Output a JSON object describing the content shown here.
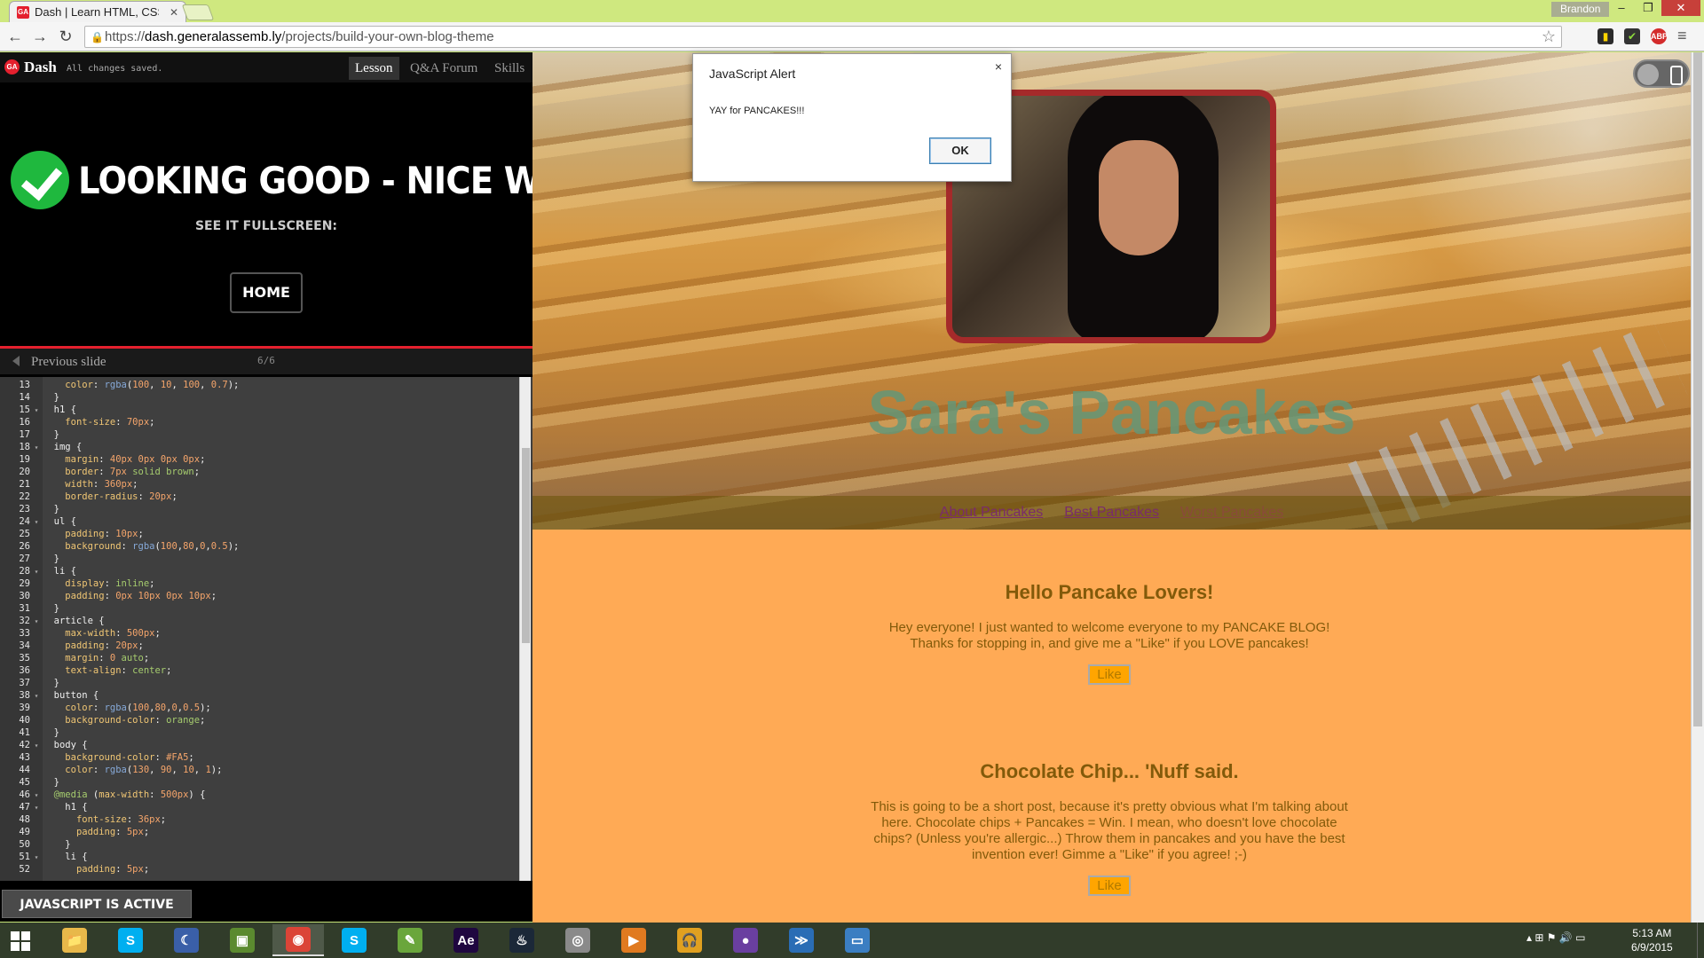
{
  "browser": {
    "tab_title": "Dash | Learn HTML, CSS, J",
    "tab_favicon_text": "GA",
    "user_name": "Brandon",
    "url": {
      "prefix": "https://",
      "host": "dash.generalassemb.ly",
      "path": "/projects/build-your-own-blog-theme"
    },
    "window_controls": {
      "minimize": "–",
      "maximize": "❐",
      "close": "✕"
    }
  },
  "dash": {
    "logo_text": "GA",
    "brand": "Dash",
    "save_status": "All changes saved.",
    "tabs": [
      {
        "label": "Lesson",
        "active": true
      },
      {
        "label": "Q&A Forum",
        "active": false
      },
      {
        "label": "Skills",
        "active": false
      }
    ],
    "success_title": "LOOKING GOOD - NICE WORK!",
    "fullscreen_label": "SEE IT FULLSCREEN:",
    "home_button": "HOME",
    "previous_slide": "Previous slide",
    "slide_count": "6/6",
    "js_status": "JAVASCRIPT IS ACTIVE"
  },
  "editor": {
    "lines": [
      {
        "n": "13",
        "fold": "",
        "indent": "    ",
        "html": "<span class=\"prop\">color</span>: <span class=\"fn\">rgba</span>(<span class=\"num\">100</span>, <span class=\"num\">10</span>, <span class=\"num\">100</span>, <span class=\"num\">0.7</span>);"
      },
      {
        "n": "14",
        "fold": "",
        "indent": "  ",
        "html": "}"
      },
      {
        "n": "15",
        "fold": "▾",
        "indent": "  ",
        "html": "h1 {"
      },
      {
        "n": "16",
        "fold": "",
        "indent": "    ",
        "html": "<span class=\"prop\">font-size</span>: <span class=\"num\">70px</span>;"
      },
      {
        "n": "17",
        "fold": "",
        "indent": "  ",
        "html": "}"
      },
      {
        "n": "18",
        "fold": "▾",
        "indent": "  ",
        "html": "img {"
      },
      {
        "n": "19",
        "fold": "",
        "indent": "    ",
        "html": "<span class=\"prop\">margin</span>: <span class=\"num\">40px</span> <span class=\"num\">0px</span> <span class=\"num\">0px</span> <span class=\"num\">0px</span>;"
      },
      {
        "n": "20",
        "fold": "",
        "indent": "    ",
        "html": "<span class=\"prop\">border</span>: <span class=\"num\">7px</span> <span class=\"kw\">solid</span> <span class=\"kw\">brown</span>;"
      },
      {
        "n": "21",
        "fold": "",
        "indent": "    ",
        "html": "<span class=\"prop\">width</span>: <span class=\"num\">360px</span>;"
      },
      {
        "n": "22",
        "fold": "",
        "indent": "    ",
        "html": "<span class=\"prop\">border-radius</span>: <span class=\"num\">20px</span>;"
      },
      {
        "n": "23",
        "fold": "",
        "indent": "  ",
        "html": "}"
      },
      {
        "n": "24",
        "fold": "▾",
        "indent": "  ",
        "html": "ul {"
      },
      {
        "n": "25",
        "fold": "",
        "indent": "    ",
        "html": "<span class=\"prop\">padding</span>: <span class=\"num\">10px</span>;"
      },
      {
        "n": "26",
        "fold": "",
        "indent": "    ",
        "html": "<span class=\"prop\">background</span>: <span class=\"fn\">rgba</span>(<span class=\"num\">100</span>,<span class=\"num\">80</span>,<span class=\"num\">0</span>,<span class=\"num\">0.5</span>);"
      },
      {
        "n": "27",
        "fold": "",
        "indent": "  ",
        "html": "}"
      },
      {
        "n": "28",
        "fold": "▾",
        "indent": "  ",
        "html": "li {"
      },
      {
        "n": "29",
        "fold": "",
        "indent": "    ",
        "html": "<span class=\"prop\">display</span>: <span class=\"kw\">inline</span>;"
      },
      {
        "n": "30",
        "fold": "",
        "indent": "    ",
        "html": "<span class=\"prop\">padding</span>: <span class=\"num\">0px</span> <span class=\"num\">10px</span> <span class=\"num\">0px</span> <span class=\"num\">10px</span>;"
      },
      {
        "n": "31",
        "fold": "",
        "indent": "  ",
        "html": "}"
      },
      {
        "n": "32",
        "fold": "▾",
        "indent": "  ",
        "html": "article {"
      },
      {
        "n": "33",
        "fold": "",
        "indent": "    ",
        "html": "<span class=\"prop\">max-width</span>: <span class=\"num\">500px</span>;"
      },
      {
        "n": "34",
        "fold": "",
        "indent": "    ",
        "html": "<span class=\"prop\">padding</span>: <span class=\"num\">20px</span>;"
      },
      {
        "n": "35",
        "fold": "",
        "indent": "    ",
        "html": "<span class=\"prop\">margin</span>: <span class=\"num\">0</span> <span class=\"kw\">auto</span>;"
      },
      {
        "n": "36",
        "fold": "",
        "indent": "    ",
        "html": "<span class=\"prop\">text-align</span>: <span class=\"kw\">center</span>;"
      },
      {
        "n": "37",
        "fold": "",
        "indent": "  ",
        "html": "}"
      },
      {
        "n": "38",
        "fold": "▾",
        "indent": "  ",
        "html": "button {"
      },
      {
        "n": "39",
        "fold": "",
        "indent": "    ",
        "html": "<span class=\"prop\">color</span>: <span class=\"fn\">rgba</span>(<span class=\"num\">100</span>,<span class=\"num\">80</span>,<span class=\"num\">0</span>,<span class=\"num\">0.5</span>);"
      },
      {
        "n": "40",
        "fold": "",
        "indent": "    ",
        "html": "<span class=\"prop\">background-color</span>: <span class=\"kw\">orange</span>;"
      },
      {
        "n": "41",
        "fold": "",
        "indent": "  ",
        "html": "}"
      },
      {
        "n": "42",
        "fold": "▾",
        "indent": "  ",
        "html": "body {"
      },
      {
        "n": "43",
        "fold": "",
        "indent": "    ",
        "html": "<span class=\"prop\">background-color</span>: <span class=\"num\">#FA5</span>;"
      },
      {
        "n": "44",
        "fold": "",
        "indent": "    ",
        "html": "<span class=\"prop\">color</span>: <span class=\"fn\">rgba</span>(<span class=\"num\">130</span>, <span class=\"num\">90</span>, <span class=\"num\">10</span>, <span class=\"num\">1</span>);"
      },
      {
        "n": "45",
        "fold": "",
        "indent": "  ",
        "html": "}"
      },
      {
        "n": "46",
        "fold": "▾",
        "indent": "  ",
        "html": "<span class=\"kw\">@media</span> (<span class=\"prop\">max-width</span>: <span class=\"num\">500px</span>) {"
      },
      {
        "n": "47",
        "fold": "▾",
        "indent": "    ",
        "html": "h1 {"
      },
      {
        "n": "48",
        "fold": "",
        "indent": "      ",
        "html": "<span class=\"prop\">font-size</span>: <span class=\"num\">36px</span>;"
      },
      {
        "n": "49",
        "fold": "",
        "indent": "      ",
        "html": "<span class=\"prop\">padding</span>: <span class=\"num\">5px</span>;"
      },
      {
        "n": "50",
        "fold": "",
        "indent": "    ",
        "html": "}"
      },
      {
        "n": "51",
        "fold": "▾",
        "indent": "    ",
        "html": "li {"
      },
      {
        "n": "52",
        "fold": "",
        "indent": "      ",
        "html": "<span class=\"prop\">padding</span>: <span class=\"num\">5px</span>;"
      }
    ]
  },
  "preview": {
    "blog_title": "Sara's Pancakes",
    "nav": [
      "About Pancakes",
      "Best Pancakes",
      "Worst Pancakes"
    ],
    "articles": [
      {
        "title": "Hello Pancake Lovers!",
        "body": "Hey everyone! I just wanted to welcome everyone to my PANCAKE BLOG! Thanks for stopping in, and give me a \"Like\" if you LOVE pancakes!",
        "button": "Like"
      },
      {
        "title": "Chocolate Chip... 'Nuff said.",
        "body": "This is going to be a short post, because it's pretty obvious what I'm talking about here. Chocolate chips + Pancakes = Win. I mean, who doesn't love chocolate chips? (Unless you're allergic...) Throw them in pancakes and you have the best invention ever! Gimme a \"Like\" if you agree! ;-)",
        "button": "Like"
      }
    ]
  },
  "alert": {
    "title": "JavaScript Alert",
    "message": "YAY for PANCAKES!!!",
    "ok": "OK",
    "close": "×"
  },
  "taskbar": {
    "apps": [
      {
        "name": "file-explorer",
        "glyph": "📁",
        "bg": "#e8b84a"
      },
      {
        "name": "skype",
        "glyph": "S",
        "bg": "#00aff0"
      },
      {
        "name": "moon-app",
        "glyph": "☾",
        "bg": "#3a5fa8"
      },
      {
        "name": "minecraft",
        "glyph": "▣",
        "bg": "#5b8a2f"
      },
      {
        "name": "chrome",
        "glyph": "◉",
        "bg": "#db4437"
      },
      {
        "name": "skype-2",
        "glyph": "S",
        "bg": "#00aff0"
      },
      {
        "name": "notepad",
        "glyph": "✎",
        "bg": "#6aa63c"
      },
      {
        "name": "after-effects",
        "glyph": "Ae",
        "bg": "#1f0740"
      },
      {
        "name": "steam",
        "glyph": "♨",
        "bg": "#1b2838"
      },
      {
        "name": "disc",
        "glyph": "◎",
        "bg": "#8a8a8a"
      },
      {
        "name": "media-player",
        "glyph": "▶",
        "bg": "#e07a20"
      },
      {
        "name": "headphones",
        "glyph": "🎧",
        "bg": "#e0a020"
      },
      {
        "name": "cat-app",
        "glyph": "●",
        "bg": "#6a3fa0"
      },
      {
        "name": "powershell",
        "glyph": "≫",
        "bg": "#2a6db5"
      },
      {
        "name": "window-app",
        "glyph": "▭",
        "bg": "#3b7ec2"
      }
    ],
    "clock_time": "5:13 AM",
    "clock_date": "6/9/2015"
  }
}
